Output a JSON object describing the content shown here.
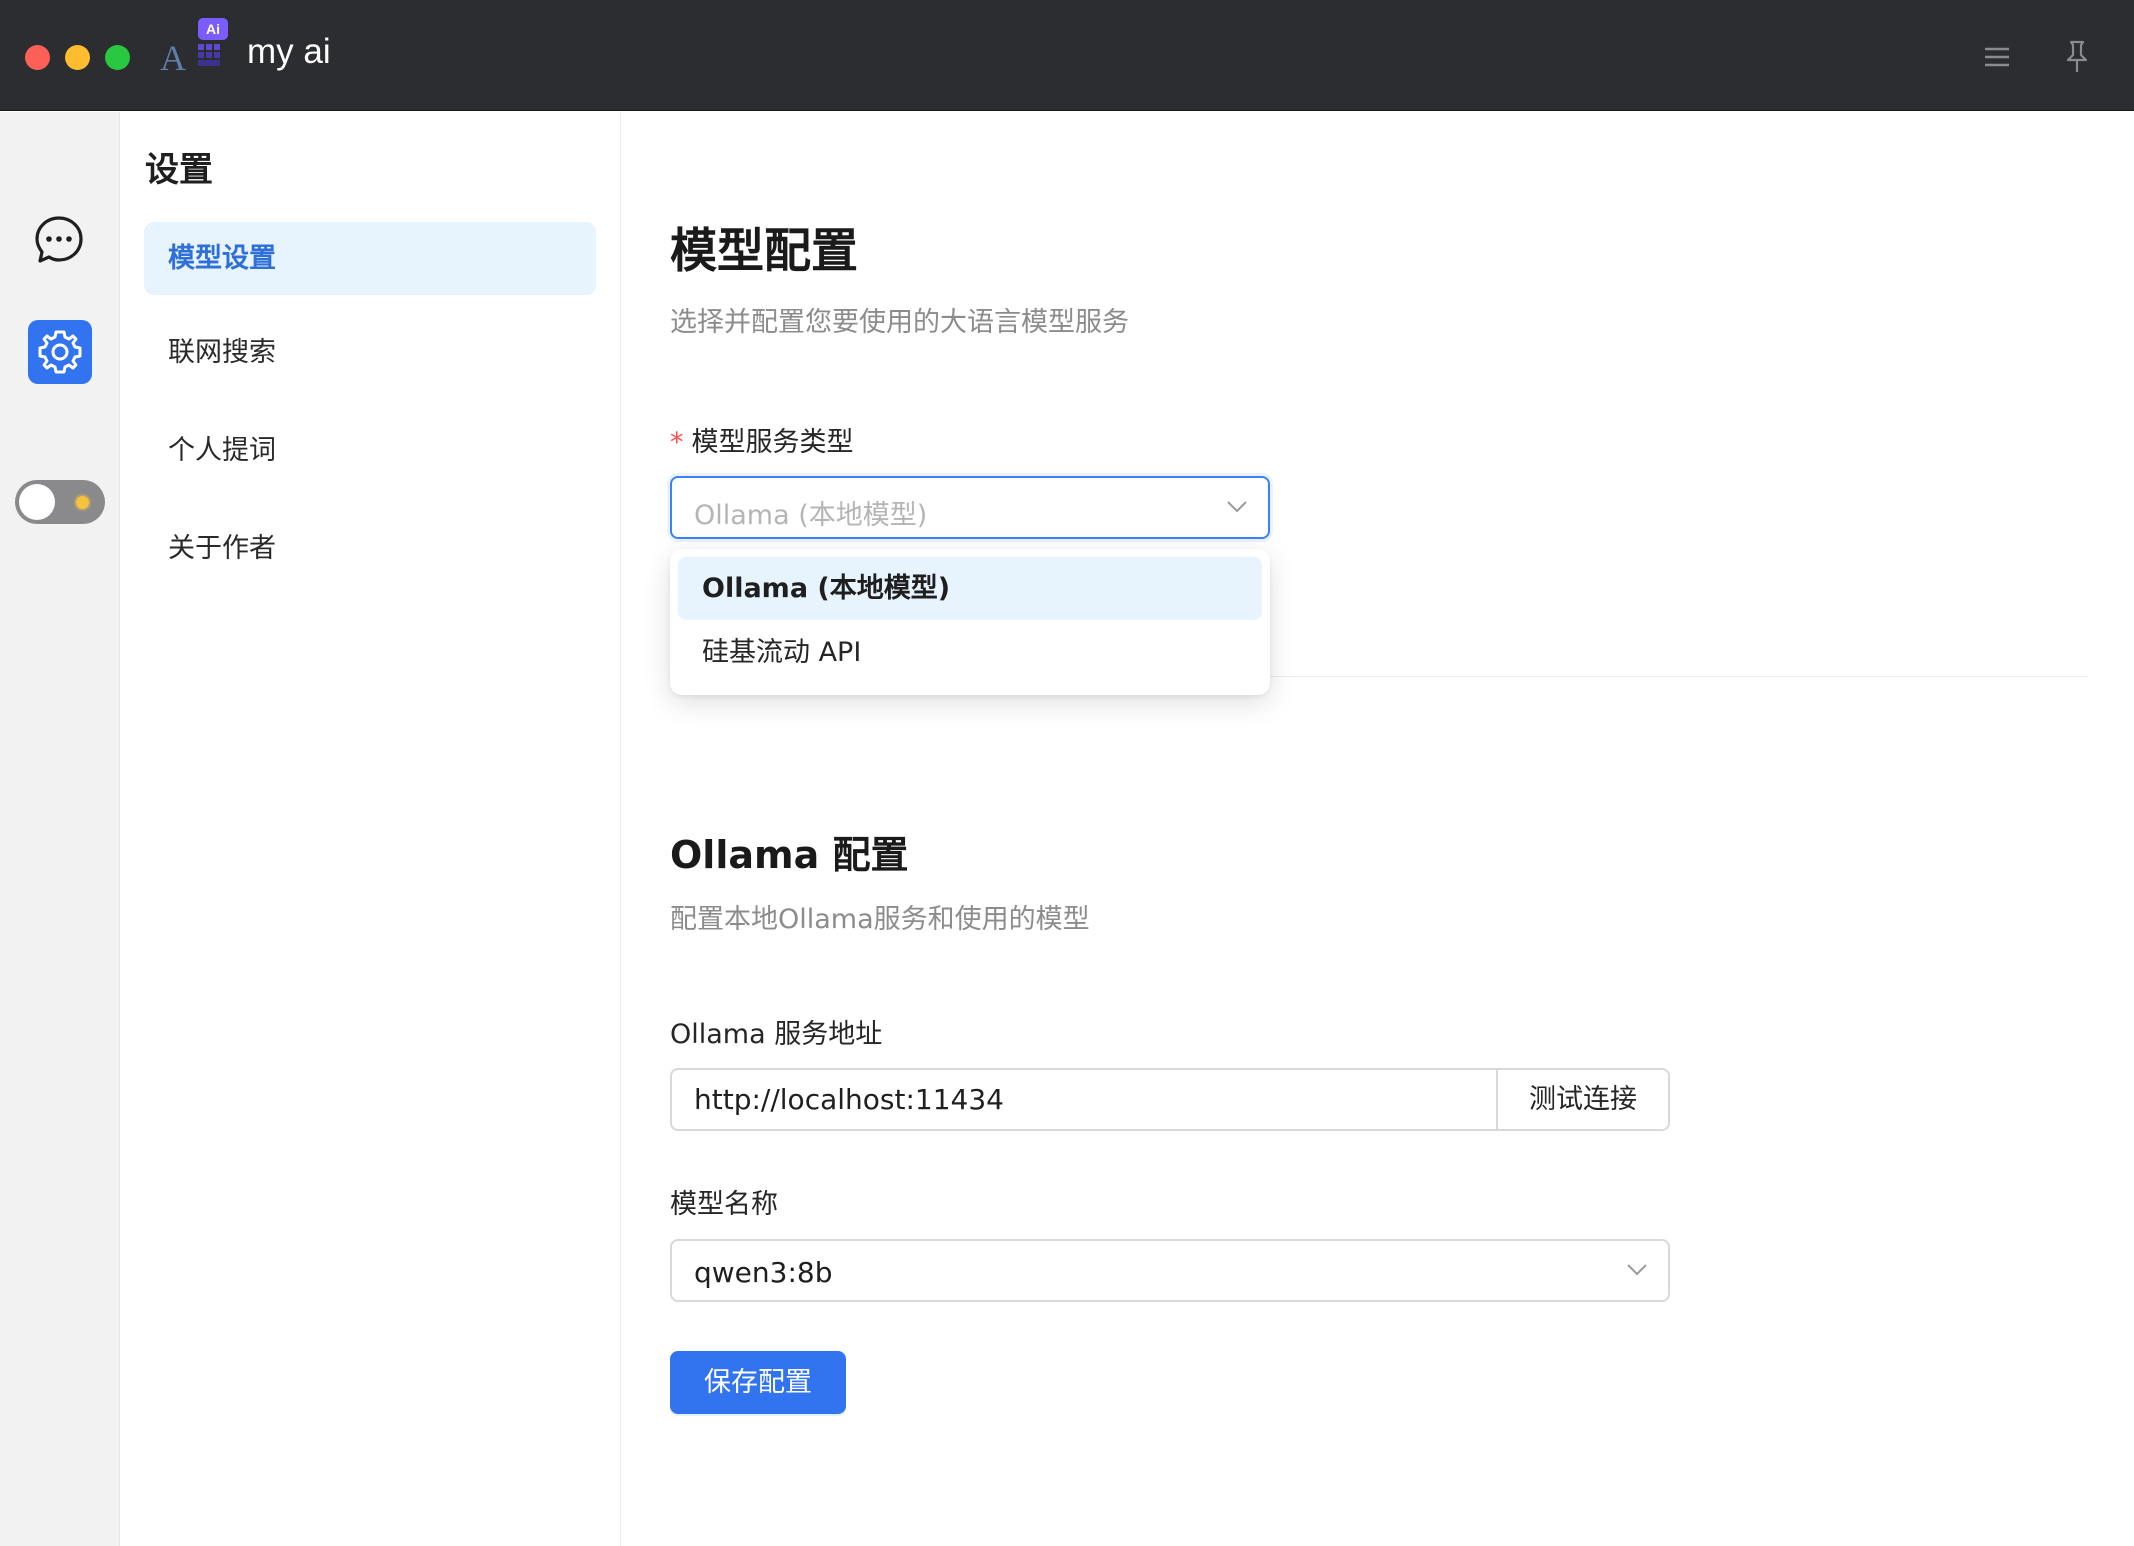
{
  "app": {
    "title": "my ai",
    "logo_badge": "Ai",
    "logo_letter": "A"
  },
  "titlebar": {
    "menu_icon": "hamburger-menu-icon",
    "pin_icon": "pin-icon"
  },
  "rail": {
    "items": [
      {
        "name": "chat",
        "icon": "chat-bubble-icon"
      },
      {
        "name": "settings",
        "icon": "gear-icon",
        "active": true
      }
    ],
    "theme_toggle": {
      "state": "light",
      "icon": "sun-icon"
    }
  },
  "settings_nav": {
    "title": "设置",
    "items": [
      {
        "label": "模型设置",
        "active": true
      },
      {
        "label": "联网搜索"
      },
      {
        "label": "个人提词"
      },
      {
        "label": "关于作者"
      }
    ]
  },
  "main": {
    "heading": "模型配置",
    "description": "选择并配置您要使用的大语言模型服务",
    "service_type": {
      "label": "模型服务类型",
      "required_mark": "*",
      "placeholder": "Ollama (本地模型)",
      "options": [
        "Ollama (本地模型)",
        "硅基流动 API"
      ],
      "selected_index": 0
    },
    "ollama": {
      "heading": "Ollama 配置",
      "description": "配置本地Ollama服务和使用的模型",
      "url_label": "Ollama 服务地址",
      "url_value": "http://localhost:11434",
      "test_button": "测试连接",
      "model_label": "模型名称",
      "model_value": "qwen3:8b",
      "save_button": "保存配置"
    }
  },
  "colors": {
    "accent": "#3274f0",
    "active_bg": "#e7f3fd",
    "active_text": "#2f6fd8",
    "titlebar_bg": "#2c2d30",
    "required": "#ff4d4f"
  }
}
